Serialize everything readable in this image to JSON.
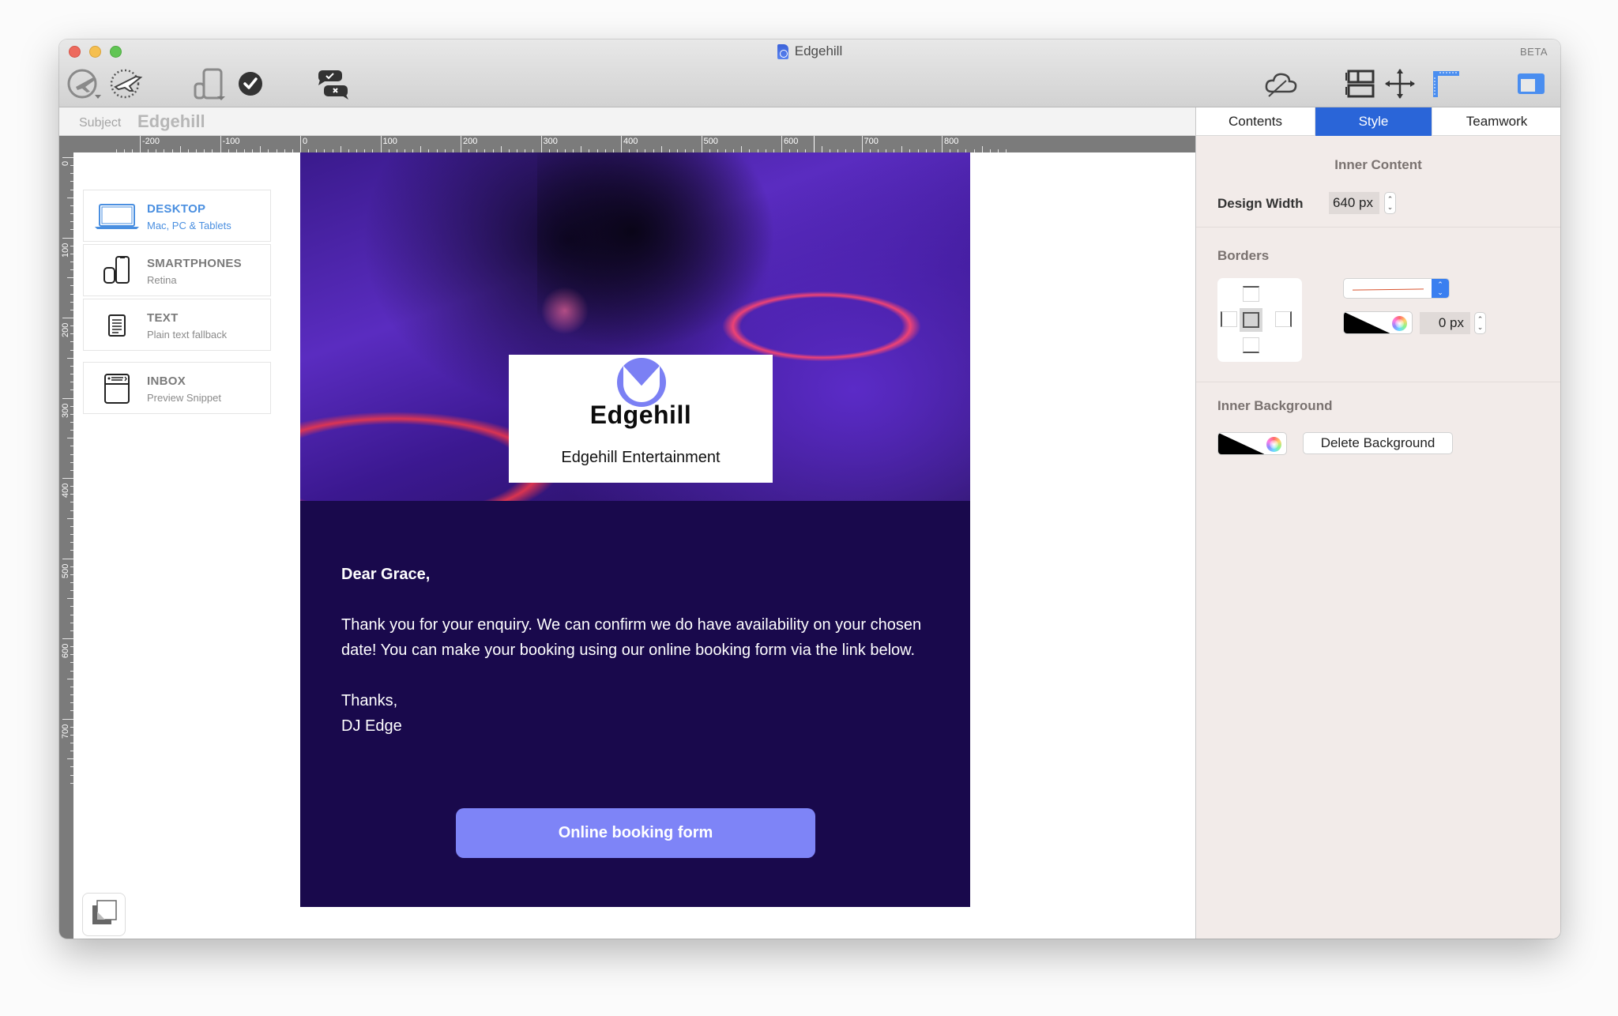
{
  "window": {
    "title": "Edgehill",
    "badge": "BETA",
    "traffic_lights": [
      "close",
      "minimize",
      "maximize"
    ]
  },
  "toolbar": {
    "left_icons": [
      "send-test-icon",
      "schedule-send-icon",
      "device-preview-icon",
      "checkmark-icon",
      "approve-reject-comments-icon"
    ],
    "right_icons": [
      "cloud-sync-icon",
      "layout-blocks-icon",
      "move-icon",
      "ruler-guides-icon",
      "sidebar-toggle-icon"
    ]
  },
  "subject": {
    "label": "Subject",
    "value": "Edgehill"
  },
  "rulers": {
    "horizontal_labels": [
      "-200",
      "-100",
      "0",
      "100",
      "200",
      "300",
      "400",
      "500",
      "600",
      "700",
      "800"
    ],
    "vertical_labels": [
      "0",
      "100",
      "200",
      "300",
      "400",
      "500",
      "600",
      "700"
    ]
  },
  "devices": [
    {
      "name": "DESKTOP",
      "sub": "Mac, PC & Tablets",
      "icon": "laptop-icon",
      "active": true
    },
    {
      "name": "SMARTPHONES",
      "sub": "Retina",
      "icon": "smartphone-icon",
      "active": false
    },
    {
      "name": "TEXT",
      "sub": "Plain text fallback",
      "icon": "text-document-icon",
      "active": false
    },
    {
      "name": "INBOX",
      "sub": "Preview Snippet",
      "icon": "inbox-preview-icon",
      "active": false
    }
  ],
  "email": {
    "logo_word": "Edgehill",
    "tagline": "Edgehill Entertainment",
    "greeting": "Dear Grace,",
    "paragraph": "Thank you for your enquiry. We can confirm we do have availability on your chosen date! You can make your booking using our online booking form via the link below.",
    "signoff_1": "Thanks,",
    "signoff_2": "DJ Edge",
    "cta_label": "Online booking form",
    "colors": {
      "body_background": "#19094c",
      "accent": "#7e84f7"
    }
  },
  "inspector": {
    "tabs": [
      {
        "label": "Contents",
        "active": false
      },
      {
        "label": "Style",
        "active": true
      },
      {
        "label": "Teamwork",
        "active": false
      }
    ],
    "inner_content_title": "Inner Content",
    "design_width_label": "Design Width",
    "design_width_value": "640 px",
    "borders_title": "Borders",
    "border_width_value": "0 px",
    "border_style": "solid",
    "border_style_color": "#d9532e",
    "inner_background_title": "Inner Background",
    "delete_background_label": "Delete Background",
    "active_tab_color": "#2a65d8"
  }
}
